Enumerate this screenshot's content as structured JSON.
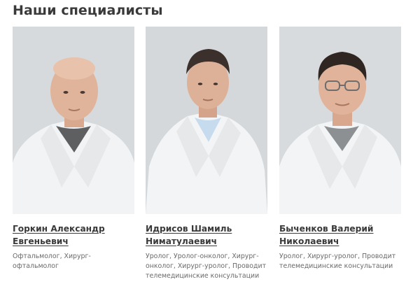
{
  "section": {
    "title": "Наши специалисты"
  },
  "doctors": [
    {
      "name": "Горкин Александр\nЕвгеньевич",
      "specialty": "Офтальмолог, Хирург-офтальмолог"
    },
    {
      "name": "Идрисов Шамиль\nНиматулаевич",
      "specialty": "Уролог, Уролог-онколог, Хирург-онколог, Хирург-уролог, Проводит телемедицинские консультации"
    },
    {
      "name": "Быченков Валерий\nНиколаевич",
      "specialty": "Уролог, Хирург-уролог, Проводит телемедицинские консультации"
    }
  ],
  "colors": {
    "title": "#3a3a3a",
    "photo_bg": "#d6d9db",
    "coat": "#f4f5f6",
    "muted_text": "#6a6a6a"
  }
}
